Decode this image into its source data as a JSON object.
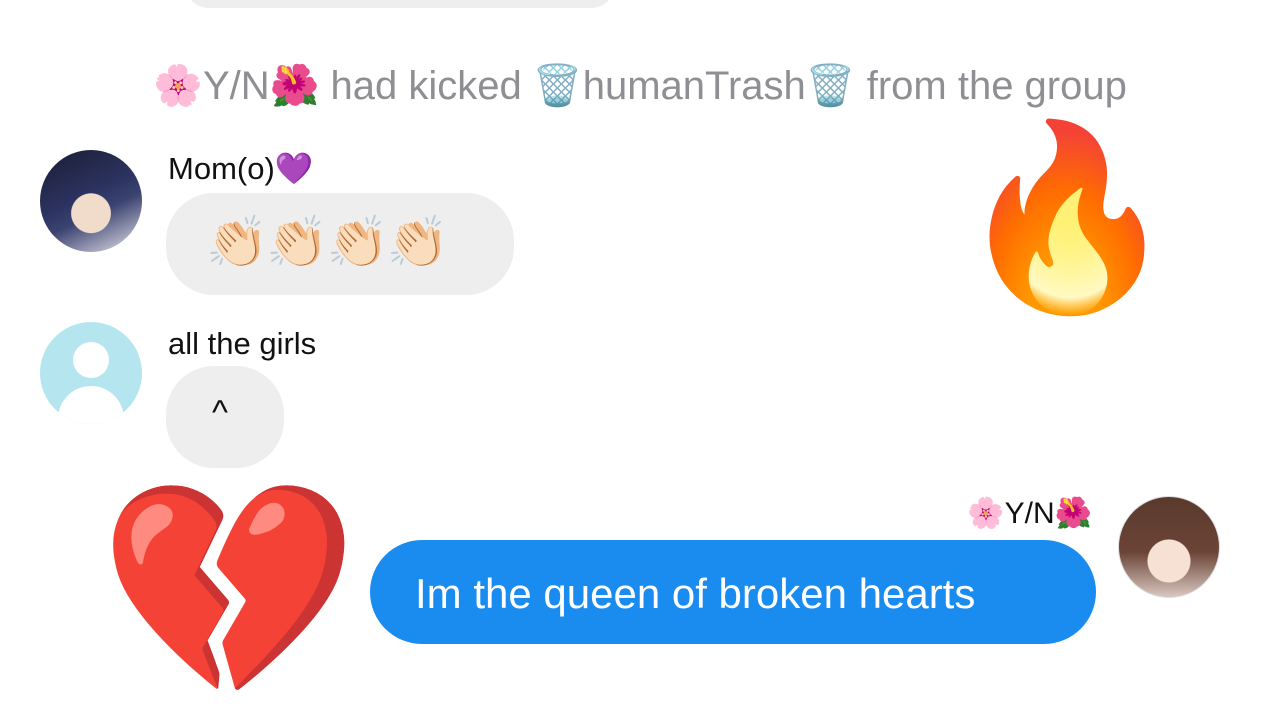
{
  "system_message": {
    "actor_prefix_emoji": "🌸",
    "actor_name": "Y/N",
    "actor_suffix_emoji": "🌺",
    "action": " had kicked ",
    "target_prefix_emoji": "🗑️",
    "target_name": "humanTrash",
    "target_suffix_emoji": "🗑️",
    "suffix": " from the group"
  },
  "messages": [
    {
      "sender": "Mom(o)💜",
      "text": "👏🏻👏🏻👏🏻👏🏻"
    },
    {
      "sender": "all the girls",
      "text": "^"
    },
    {
      "sender": "🌸Y/N🌺",
      "text": "Im the queen of broken hearts"
    }
  ],
  "stickers": {
    "fire": "🔥",
    "broken_heart": "💔"
  },
  "colors": {
    "outgoing_bubble": "#1a8cf0",
    "incoming_bubble": "#eeeeee",
    "system_text": "#8e8e93"
  }
}
